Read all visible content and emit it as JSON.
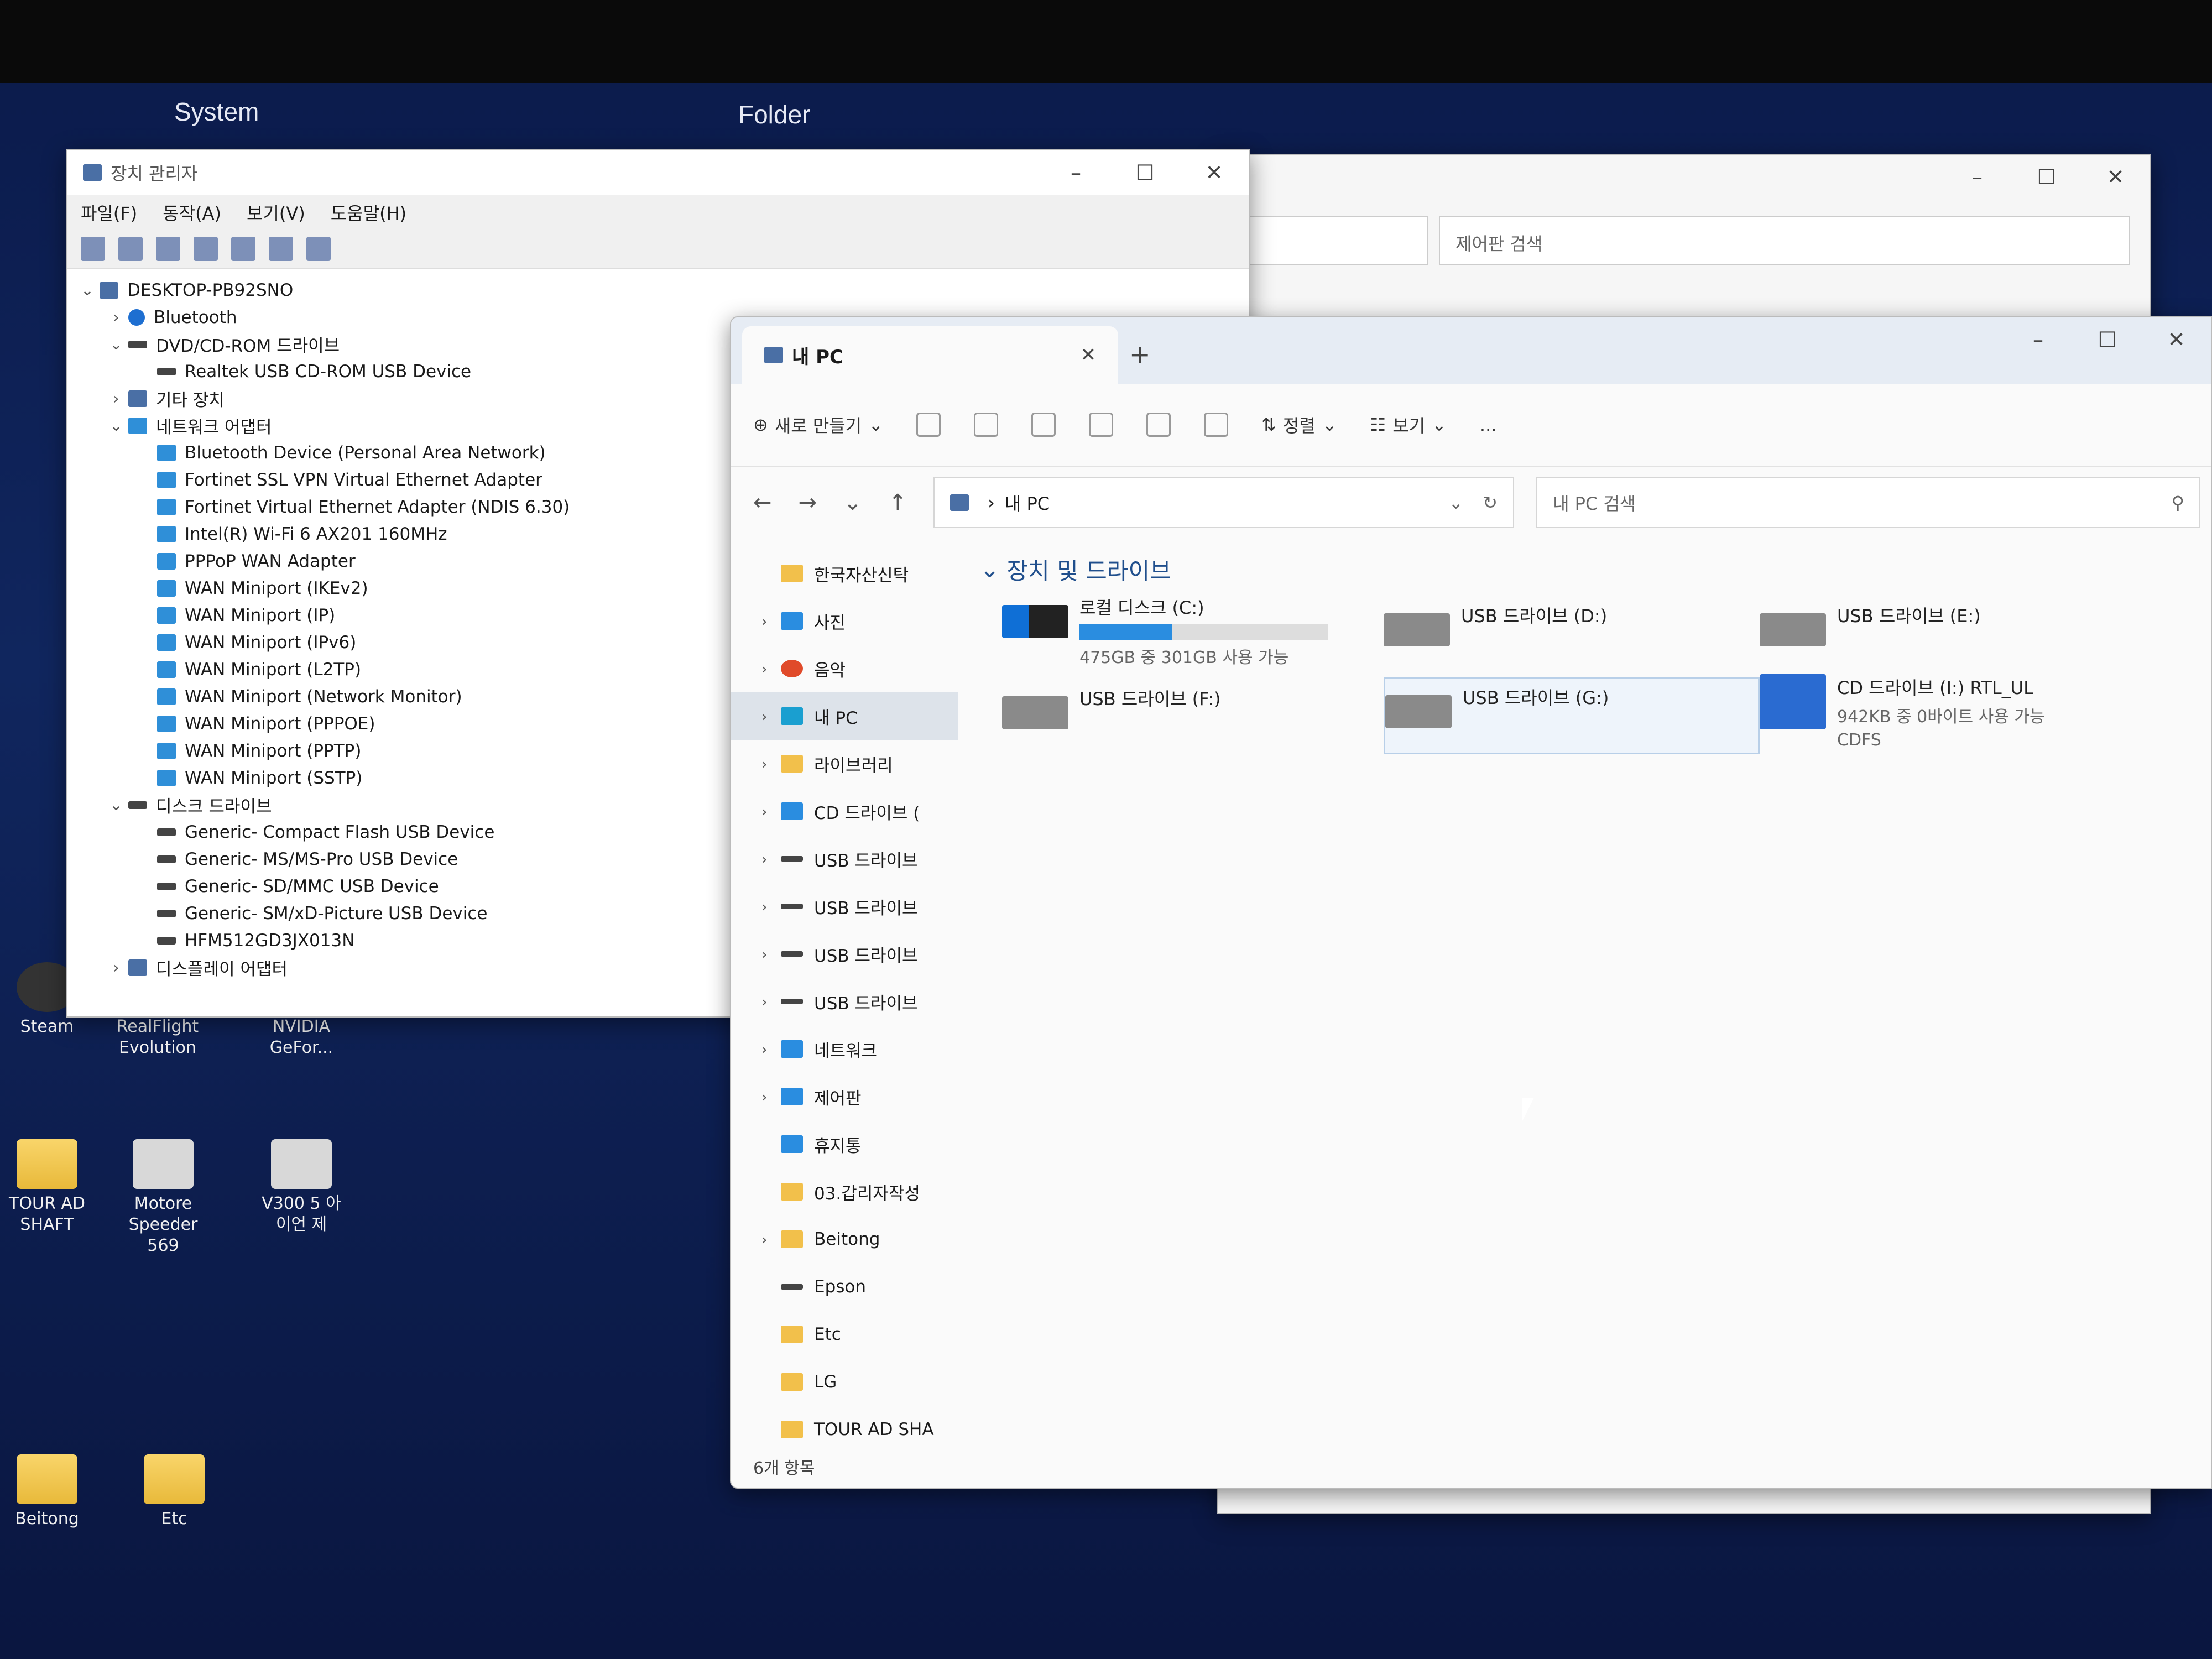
{
  "desktop": {
    "left_label": "System",
    "right_label": "Folder",
    "icons": [
      {
        "label": "Steam"
      },
      {
        "label": "RealFlight Evolution"
      },
      {
        "label": "NVIDIA GeFor..."
      },
      {
        "label": "TOUR AD SHAFT"
      },
      {
        "label": "Motore Speeder 569"
      },
      {
        "label": "V300 5 아이언 제"
      },
      {
        "label": "Beitong"
      },
      {
        "label": "Etc"
      }
    ]
  },
  "control_panel": {
    "search_placeholder": "제어판 검색"
  },
  "device_manager": {
    "title": "장치 관리자",
    "menu": [
      "파일(F)",
      "동작(A)",
      "보기(V)",
      "도움말(H)"
    ],
    "tree": [
      {
        "label": "DESKTOP-PB92SNO",
        "level": 0,
        "chev": "v",
        "icon": "pc"
      },
      {
        "label": "Bluetooth",
        "level": 1,
        "chev": ">",
        "icon": "bt"
      },
      {
        "label": "DVD/CD-ROM 드라이브",
        "level": 1,
        "chev": "v",
        "icon": "disk"
      },
      {
        "label": "Realtek USB CD-ROM USB Device",
        "level": 2,
        "chev": "",
        "icon": "disk"
      },
      {
        "label": "기타 장치",
        "level": 1,
        "chev": ">",
        "icon": "pc"
      },
      {
        "label": "네트워크 어댑터",
        "level": 1,
        "chev": "v",
        "icon": "net"
      },
      {
        "label": "Bluetooth Device (Personal Area Network)",
        "level": 2,
        "chev": "",
        "icon": "net"
      },
      {
        "label": "Fortinet SSL VPN Virtual Ethernet Adapter",
        "level": 2,
        "chev": "",
        "icon": "net"
      },
      {
        "label": "Fortinet Virtual Ethernet Adapter (NDIS 6.30)",
        "level": 2,
        "chev": "",
        "icon": "net"
      },
      {
        "label": "Intel(R) Wi-Fi 6 AX201 160MHz",
        "level": 2,
        "chev": "",
        "icon": "net"
      },
      {
        "label": "PPPoP WAN Adapter",
        "level": 2,
        "chev": "",
        "icon": "net"
      },
      {
        "label": "WAN Miniport (IKEv2)",
        "level": 2,
        "chev": "",
        "icon": "net"
      },
      {
        "label": "WAN Miniport (IP)",
        "level": 2,
        "chev": "",
        "icon": "net"
      },
      {
        "label": "WAN Miniport (IPv6)",
        "level": 2,
        "chev": "",
        "icon": "net"
      },
      {
        "label": "WAN Miniport (L2TP)",
        "level": 2,
        "chev": "",
        "icon": "net"
      },
      {
        "label": "WAN Miniport (Network Monitor)",
        "level": 2,
        "chev": "",
        "icon": "net"
      },
      {
        "label": "WAN Miniport (PPPOE)",
        "level": 2,
        "chev": "",
        "icon": "net"
      },
      {
        "label": "WAN Miniport (PPTP)",
        "level": 2,
        "chev": "",
        "icon": "net"
      },
      {
        "label": "WAN Miniport (SSTP)",
        "level": 2,
        "chev": "",
        "icon": "net"
      },
      {
        "label": "디스크 드라이브",
        "level": 1,
        "chev": "v",
        "icon": "disk"
      },
      {
        "label": "Generic- Compact Flash USB Device",
        "level": 2,
        "chev": "",
        "icon": "disk"
      },
      {
        "label": "Generic- MS/MS-Pro USB Device",
        "level": 2,
        "chev": "",
        "icon": "disk"
      },
      {
        "label": "Generic- SD/MMC USB Device",
        "level": 2,
        "chev": "",
        "icon": "disk"
      },
      {
        "label": "Generic- SM/xD-Picture USB Device",
        "level": 2,
        "chev": "",
        "icon": "disk"
      },
      {
        "label": "HFM512GD3JX013N",
        "level": 2,
        "chev": "",
        "icon": "disk"
      },
      {
        "label": "디스플레이 어댑터",
        "level": 1,
        "chev": ">",
        "icon": "pc"
      }
    ]
  },
  "explorer": {
    "tab_title": "내 PC",
    "commands": {
      "new": "새로 만들기",
      "sort": "정렬",
      "view": "보기",
      "more": "..."
    },
    "address": "내 PC",
    "search_placeholder": "내 PC 검색",
    "nav": [
      {
        "label": "한국자산신탁",
        "chev": "",
        "icon": "folder"
      },
      {
        "label": "사진",
        "chev": ">",
        "icon": "blue"
      },
      {
        "label": "음악",
        "chev": ">",
        "icon": "red"
      },
      {
        "label": "내 PC",
        "chev": ">",
        "icon": "pc",
        "selected": true
      },
      {
        "label": "라이브러리",
        "chev": ">",
        "icon": "folder"
      },
      {
        "label": "CD 드라이브 (",
        "chev": ">",
        "icon": "blue"
      },
      {
        "label": "USB 드라이브",
        "chev": ">",
        "icon": "dark"
      },
      {
        "label": "USB 드라이브",
        "chev": ">",
        "icon": "dark"
      },
      {
        "label": "USB 드라이브",
        "chev": ">",
        "icon": "dark"
      },
      {
        "label": "USB 드라이브",
        "chev": ">",
        "icon": "dark"
      },
      {
        "label": "네트워크",
        "chev": ">",
        "icon": "blue"
      },
      {
        "label": "제어판",
        "chev": ">",
        "icon": "blue"
      },
      {
        "label": "휴지통",
        "chev": "",
        "icon": "blue"
      },
      {
        "label": "03.갑리자작성",
        "chev": "",
        "icon": "folder"
      },
      {
        "label": "Beitong",
        "chev": ">",
        "icon": "folder"
      },
      {
        "label": "Epson",
        "chev": "",
        "icon": "dark"
      },
      {
        "label": "Etc",
        "chev": "",
        "icon": "folder"
      },
      {
        "label": "LG",
        "chev": "",
        "icon": "folder"
      },
      {
        "label": "TOUR AD SHA",
        "chev": "",
        "icon": "folder"
      }
    ],
    "section_title": "장치 및 드라이브",
    "drives": [
      {
        "name": "로컬 디스크 (C:)",
        "sub": "475GB 중 301GB 사용 가능",
        "used_fraction": 0.37,
        "kind": "sys"
      },
      {
        "name": "USB 드라이브 (D:)",
        "sub": "",
        "kind": "usb"
      },
      {
        "name": "USB 드라이브 (E:)",
        "sub": "",
        "kind": "usb"
      },
      {
        "name": "USB 드라이브 (F:)",
        "sub": "",
        "kind": "usb"
      },
      {
        "name": "USB 드라이브 (G:)",
        "sub": "",
        "kind": "usb",
        "selected": true
      },
      {
        "name": "CD 드라이브 (I:) RTL_UL",
        "sub": "942KB 중 0바이트 사용 가능",
        "sub2": "CDFS",
        "kind": "cd"
      }
    ],
    "status": "6개 항목"
  }
}
